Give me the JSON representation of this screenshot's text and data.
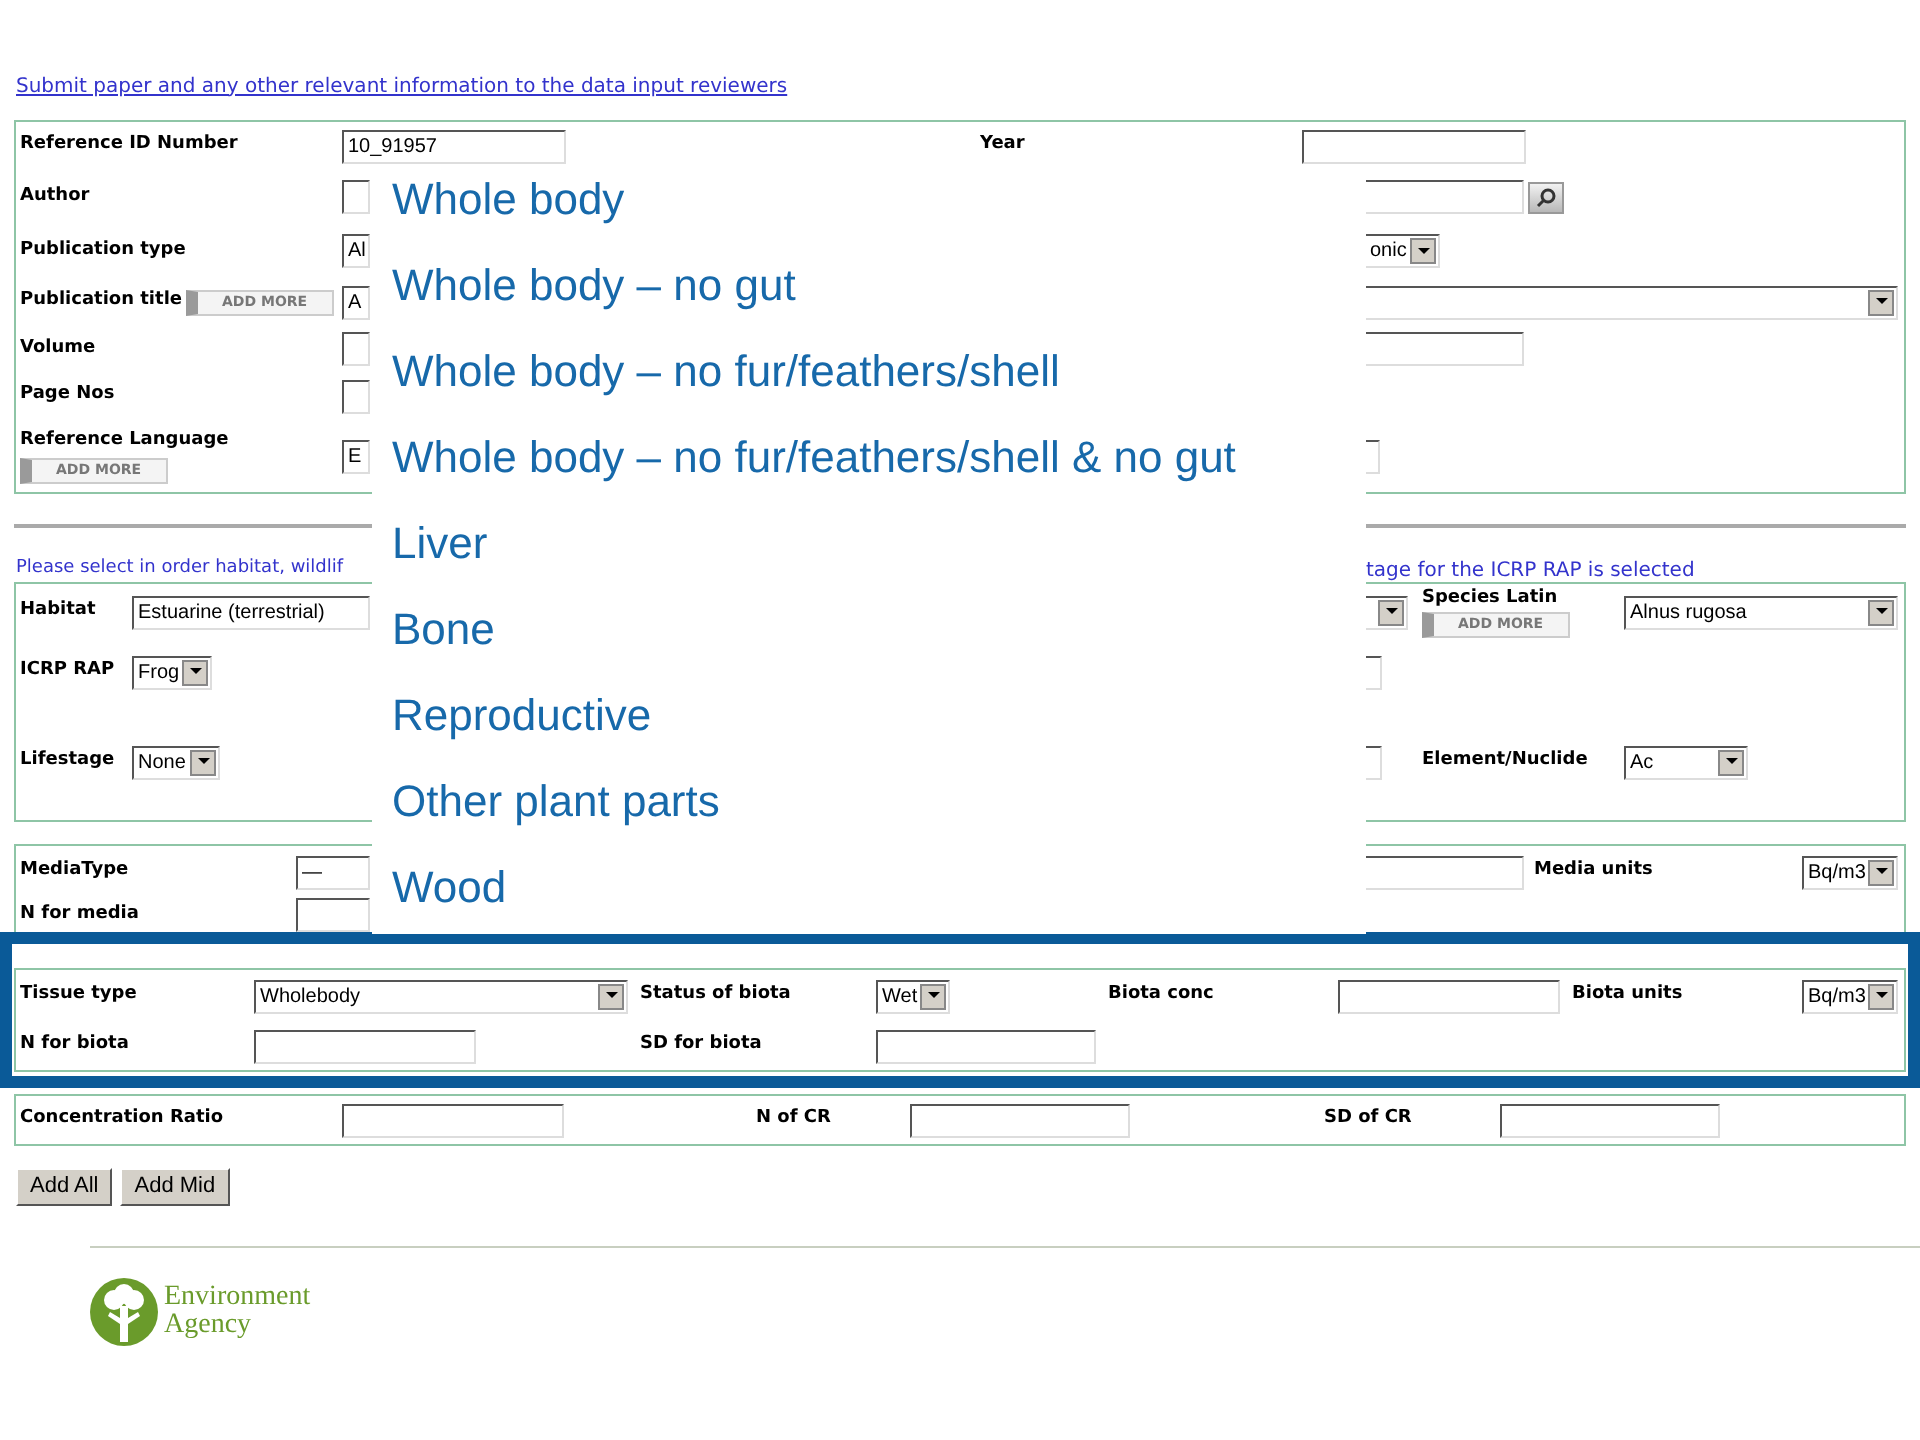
{
  "header_link": "Submit paper and any other relevant information to the data input reviewers",
  "reference": {
    "reference_id": {
      "label": "Reference ID Number",
      "value": "10_91957"
    },
    "year": {
      "label": "Year"
    },
    "author": {
      "label": "Author"
    },
    "publication_type": {
      "label": "Publication type",
      "value_left": "Al",
      "value_right": "onic"
    },
    "publication_title": {
      "label": "Publication title",
      "add_more": "ADD MORE",
      "value_left": "A"
    },
    "volume": {
      "label": "Volume"
    },
    "page_nos": {
      "label": "Page Nos"
    },
    "reference_language": {
      "label": "Reference Language",
      "add_more": "ADD MORE",
      "value_left": "E"
    }
  },
  "selection_note": [
    "Please select in order habitat, wildlif",
    "tage for the ICRP RAP is selected"
  ],
  "wildlife": {
    "habitat": {
      "label": "Habitat",
      "value": "Estuarine (terrestrial)"
    },
    "species_latin": {
      "label": "Species Latin",
      "add_more": "ADD MORE",
      "value": "Alnus rugosa"
    },
    "icrp_rap": {
      "label": "ICRP RAP",
      "value": "Frog"
    },
    "lifestage": {
      "label": "Lifestage",
      "value": "None"
    },
    "element_nuclide": {
      "label": "Element/Nuclide",
      "value": "Ac"
    }
  },
  "media": {
    "media_type": {
      "label": "MediaType",
      "value": "—"
    },
    "media_units": {
      "label": "Media units",
      "value": "Bq/m3"
    },
    "n_for_media": {
      "label": "N for media"
    }
  },
  "biota": {
    "tissue_type": {
      "label": "Tissue type",
      "value": "Wholebody"
    },
    "status": {
      "label": "Status of biota",
      "value": "Wet"
    },
    "biota_conc": {
      "label": "Biota conc"
    },
    "biota_units": {
      "label": "Biota units",
      "value": "Bq/m3"
    },
    "n_for_biota": {
      "label": "N for biota"
    },
    "sd_for_biota": {
      "label": "SD for biota"
    }
  },
  "ratio": {
    "cr": {
      "label": "Concentration Ratio"
    },
    "n_of_cr": {
      "label": "N of CR"
    },
    "sd_of_cr": {
      "label": "SD of CR"
    }
  },
  "buttons": [
    "Add All",
    "Add Mid"
  ],
  "tissue_options": [
    "Whole body",
    "Whole body – no gut",
    "Whole body – no fur/feathers/shell",
    "Whole body – no fur/feathers/shell & no gut",
    "Liver",
    "Bone",
    "Reproductive",
    "Other plant parts",
    "Wood"
  ],
  "logo": {
    "line1": "Environment",
    "line2": "Agency"
  }
}
